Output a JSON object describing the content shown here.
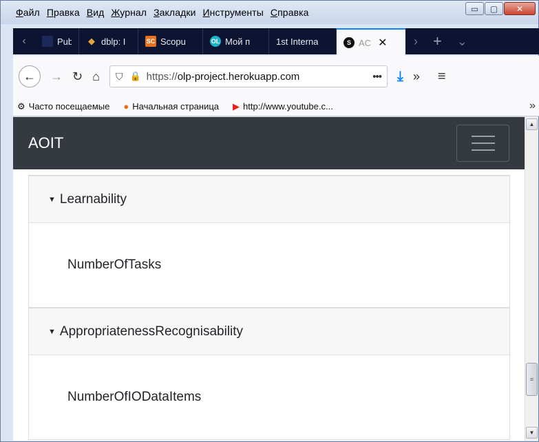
{
  "menu": [
    {
      "first": "Ф",
      "rest": "айл"
    },
    {
      "first": "П",
      "rest": "равка"
    },
    {
      "first": "В",
      "rest": "ид"
    },
    {
      "first": "Ж",
      "rest": "урнал"
    },
    {
      "first": "З",
      "rest": "акладки"
    },
    {
      "first": "И",
      "rest": "нструменты"
    },
    {
      "first": "С",
      "rest": "правка"
    }
  ],
  "window_controls": {
    "minimize": "▭",
    "maximize": "▢",
    "close": "✕"
  },
  "tabs": [
    {
      "label": "Publis",
      "icon_text": "",
      "icon_color": "#1b2a5a"
    },
    {
      "label": "dblp: I",
      "icon_text": "",
      "icon_color": "#e8a33c"
    },
    {
      "label": "Scopu",
      "icon_text": "SC",
      "icon_color": "#e9711c"
    },
    {
      "label": "Мой п",
      "icon_text": "OL",
      "icon_color": "#19b3c6"
    },
    {
      "label": "1st Interna",
      "icon_text": "",
      "icon_color": ""
    },
    {
      "label": "AC",
      "icon_text": "S",
      "icon_color": "#111111",
      "active": true
    }
  ],
  "navbar": {
    "url_prefix": "https://",
    "url_host": "olp-project.herokuapp.com",
    "dots": "•••"
  },
  "bookmarks": [
    {
      "label": "Часто посещаемые",
      "icon": "⚙"
    },
    {
      "label": "Начальная страница",
      "icon": "●"
    },
    {
      "label": "http://www.youtube.c...",
      "icon": "▶"
    }
  ],
  "app": {
    "brand": "AOIT"
  },
  "sections": [
    {
      "title": "Learnability",
      "items": [
        "NumberOfTasks"
      ]
    },
    {
      "title": "AppropriatenessRecognisability",
      "items": [
        "NumberOfIODataItems"
      ]
    }
  ],
  "colors": {
    "header_bg": "#343a40",
    "accent": "#0a84ff"
  }
}
